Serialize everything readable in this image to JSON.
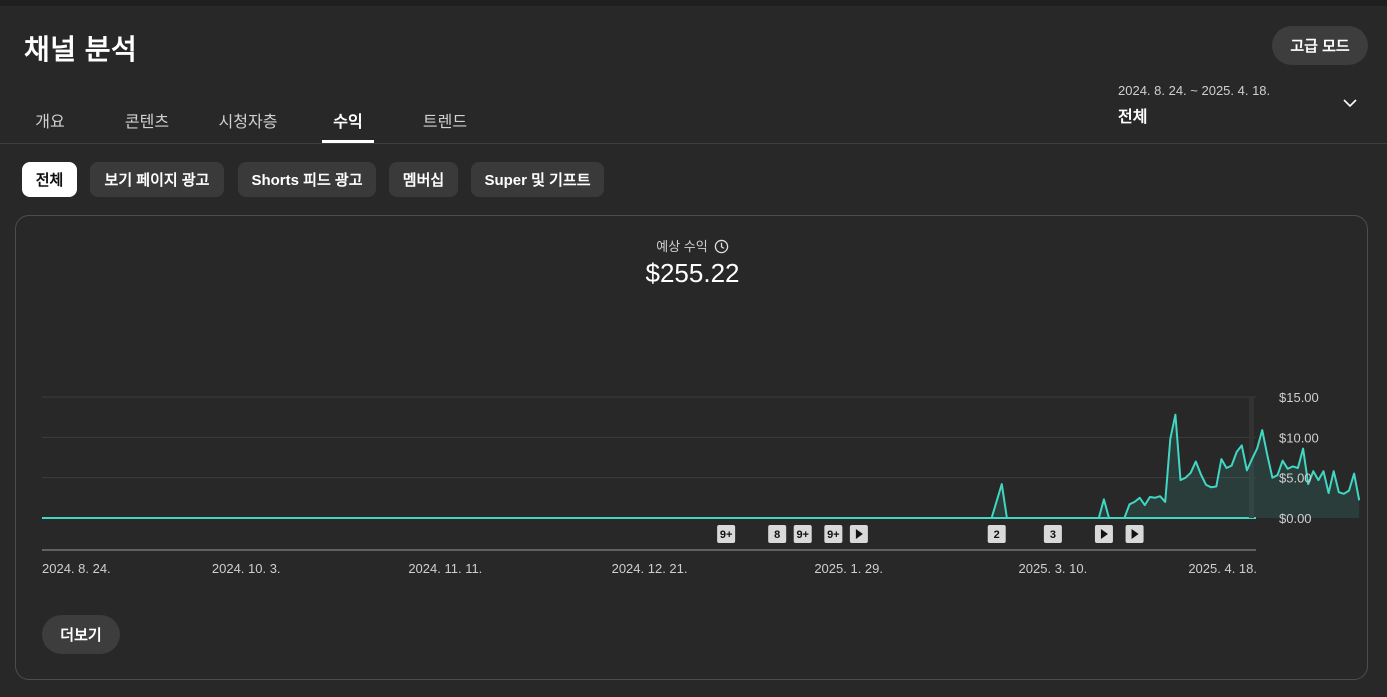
{
  "header": {
    "title": "채널 분석",
    "advanced_mode_label": "고급 모드"
  },
  "tabs": [
    {
      "label": "개요",
      "active": false
    },
    {
      "label": "콘텐츠",
      "active": false
    },
    {
      "label": "시청자층",
      "active": false
    },
    {
      "label": "수익",
      "active": true
    },
    {
      "label": "트렌드",
      "active": false
    }
  ],
  "date_range": {
    "dates": "2024. 8. 24. ~ 2025. 4. 18.",
    "selection": "전체"
  },
  "filters": [
    {
      "label": "전체",
      "active": true
    },
    {
      "label": "보기 페이지 광고",
      "active": false
    },
    {
      "label": "Shorts 피드 광고",
      "active": false
    },
    {
      "label": "멤버십",
      "active": false
    },
    {
      "label": "Super 및 기프트",
      "active": false
    }
  ],
  "metric": {
    "label": "예상 수익",
    "value": "$255.22"
  },
  "more_label": "더보기",
  "colors": {
    "accent": "#41d7c3",
    "background": "#282828",
    "grid": "#3c3c3c"
  },
  "chart_data": {
    "type": "area",
    "x_start": "2024-08-24",
    "x_end": "2025-04-18",
    "x_tick_labels": [
      "2024. 8. 24.",
      "2024. 10. 3.",
      "2024. 11. 11.",
      "2024. 12. 21.",
      "2025. 1. 29.",
      "2025. 3. 10.",
      "2025. 4. 18."
    ],
    "y_tick_labels": [
      "$15.00",
      "$10.00",
      "$5.00",
      "$0.00"
    ],
    "ylim": [
      0,
      15
    ],
    "grid": true,
    "series": [
      {
        "values": [
          [
            0,
            0
          ],
          [
            186,
            0
          ],
          [
            188,
            4.2
          ],
          [
            189,
            0
          ],
          [
            197,
            0
          ],
          [
            200,
            0
          ],
          [
            201,
            0
          ],
          [
            202,
            0
          ],
          [
            203,
            0
          ],
          [
            204,
            0
          ],
          [
            205,
            0
          ],
          [
            206,
            0
          ],
          [
            207,
            0
          ],
          [
            208,
            2.3
          ],
          [
            209,
            0
          ],
          [
            212,
            0
          ],
          [
            213,
            1.7
          ],
          [
            214,
            2.0
          ],
          [
            215,
            2.5
          ],
          [
            216,
            1.6
          ],
          [
            217,
            2.6
          ],
          [
            218,
            2.5
          ],
          [
            219,
            2.7
          ],
          [
            220,
            2.0
          ],
          [
            221,
            9.8
          ],
          [
            222,
            12.8
          ],
          [
            223,
            4.7
          ],
          [
            224,
            5.0
          ],
          [
            225,
            5.6
          ],
          [
            226,
            7.0
          ],
          [
            227,
            5.4
          ],
          [
            228,
            4.1
          ],
          [
            229,
            3.8
          ],
          [
            230,
            3.9
          ],
          [
            231,
            7.3
          ],
          [
            232,
            6.2
          ],
          [
            233,
            6.5
          ],
          [
            234,
            8.2
          ],
          [
            235,
            9.0
          ],
          [
            236,
            5.9
          ],
          [
            237,
            7.3
          ],
          [
            238,
            8.6
          ],
          [
            239,
            10.9
          ],
          [
            240,
            7.8
          ],
          [
            241,
            5.0
          ],
          [
            242,
            5.3
          ],
          [
            243,
            7.1
          ],
          [
            244,
            6.1
          ],
          [
            245,
            6.4
          ],
          [
            246,
            6.2
          ],
          [
            247,
            8.6
          ],
          [
            248,
            4.2
          ],
          [
            249,
            5.8
          ],
          [
            250,
            4.7
          ],
          [
            251,
            5.8
          ],
          [
            252,
            3.1
          ],
          [
            253,
            5.8
          ],
          [
            254,
            3.2
          ],
          [
            255,
            3.0
          ],
          [
            256,
            3.4
          ],
          [
            257,
            5.5
          ],
          [
            258,
            2.2
          ]
        ]
      }
    ],
    "markers": [
      {
        "day": 134,
        "label": "9+"
      },
      {
        "day": 144,
        "label": "8"
      },
      {
        "day": 149,
        "label": "9+"
      },
      {
        "day": 155,
        "label": "9+"
      },
      {
        "day": 160,
        "label": "play"
      },
      {
        "day": 187,
        "label": "2"
      },
      {
        "day": 198,
        "label": "3"
      },
      {
        "day": 208,
        "label": "play"
      },
      {
        "day": 214,
        "label": "play"
      }
    ]
  }
}
